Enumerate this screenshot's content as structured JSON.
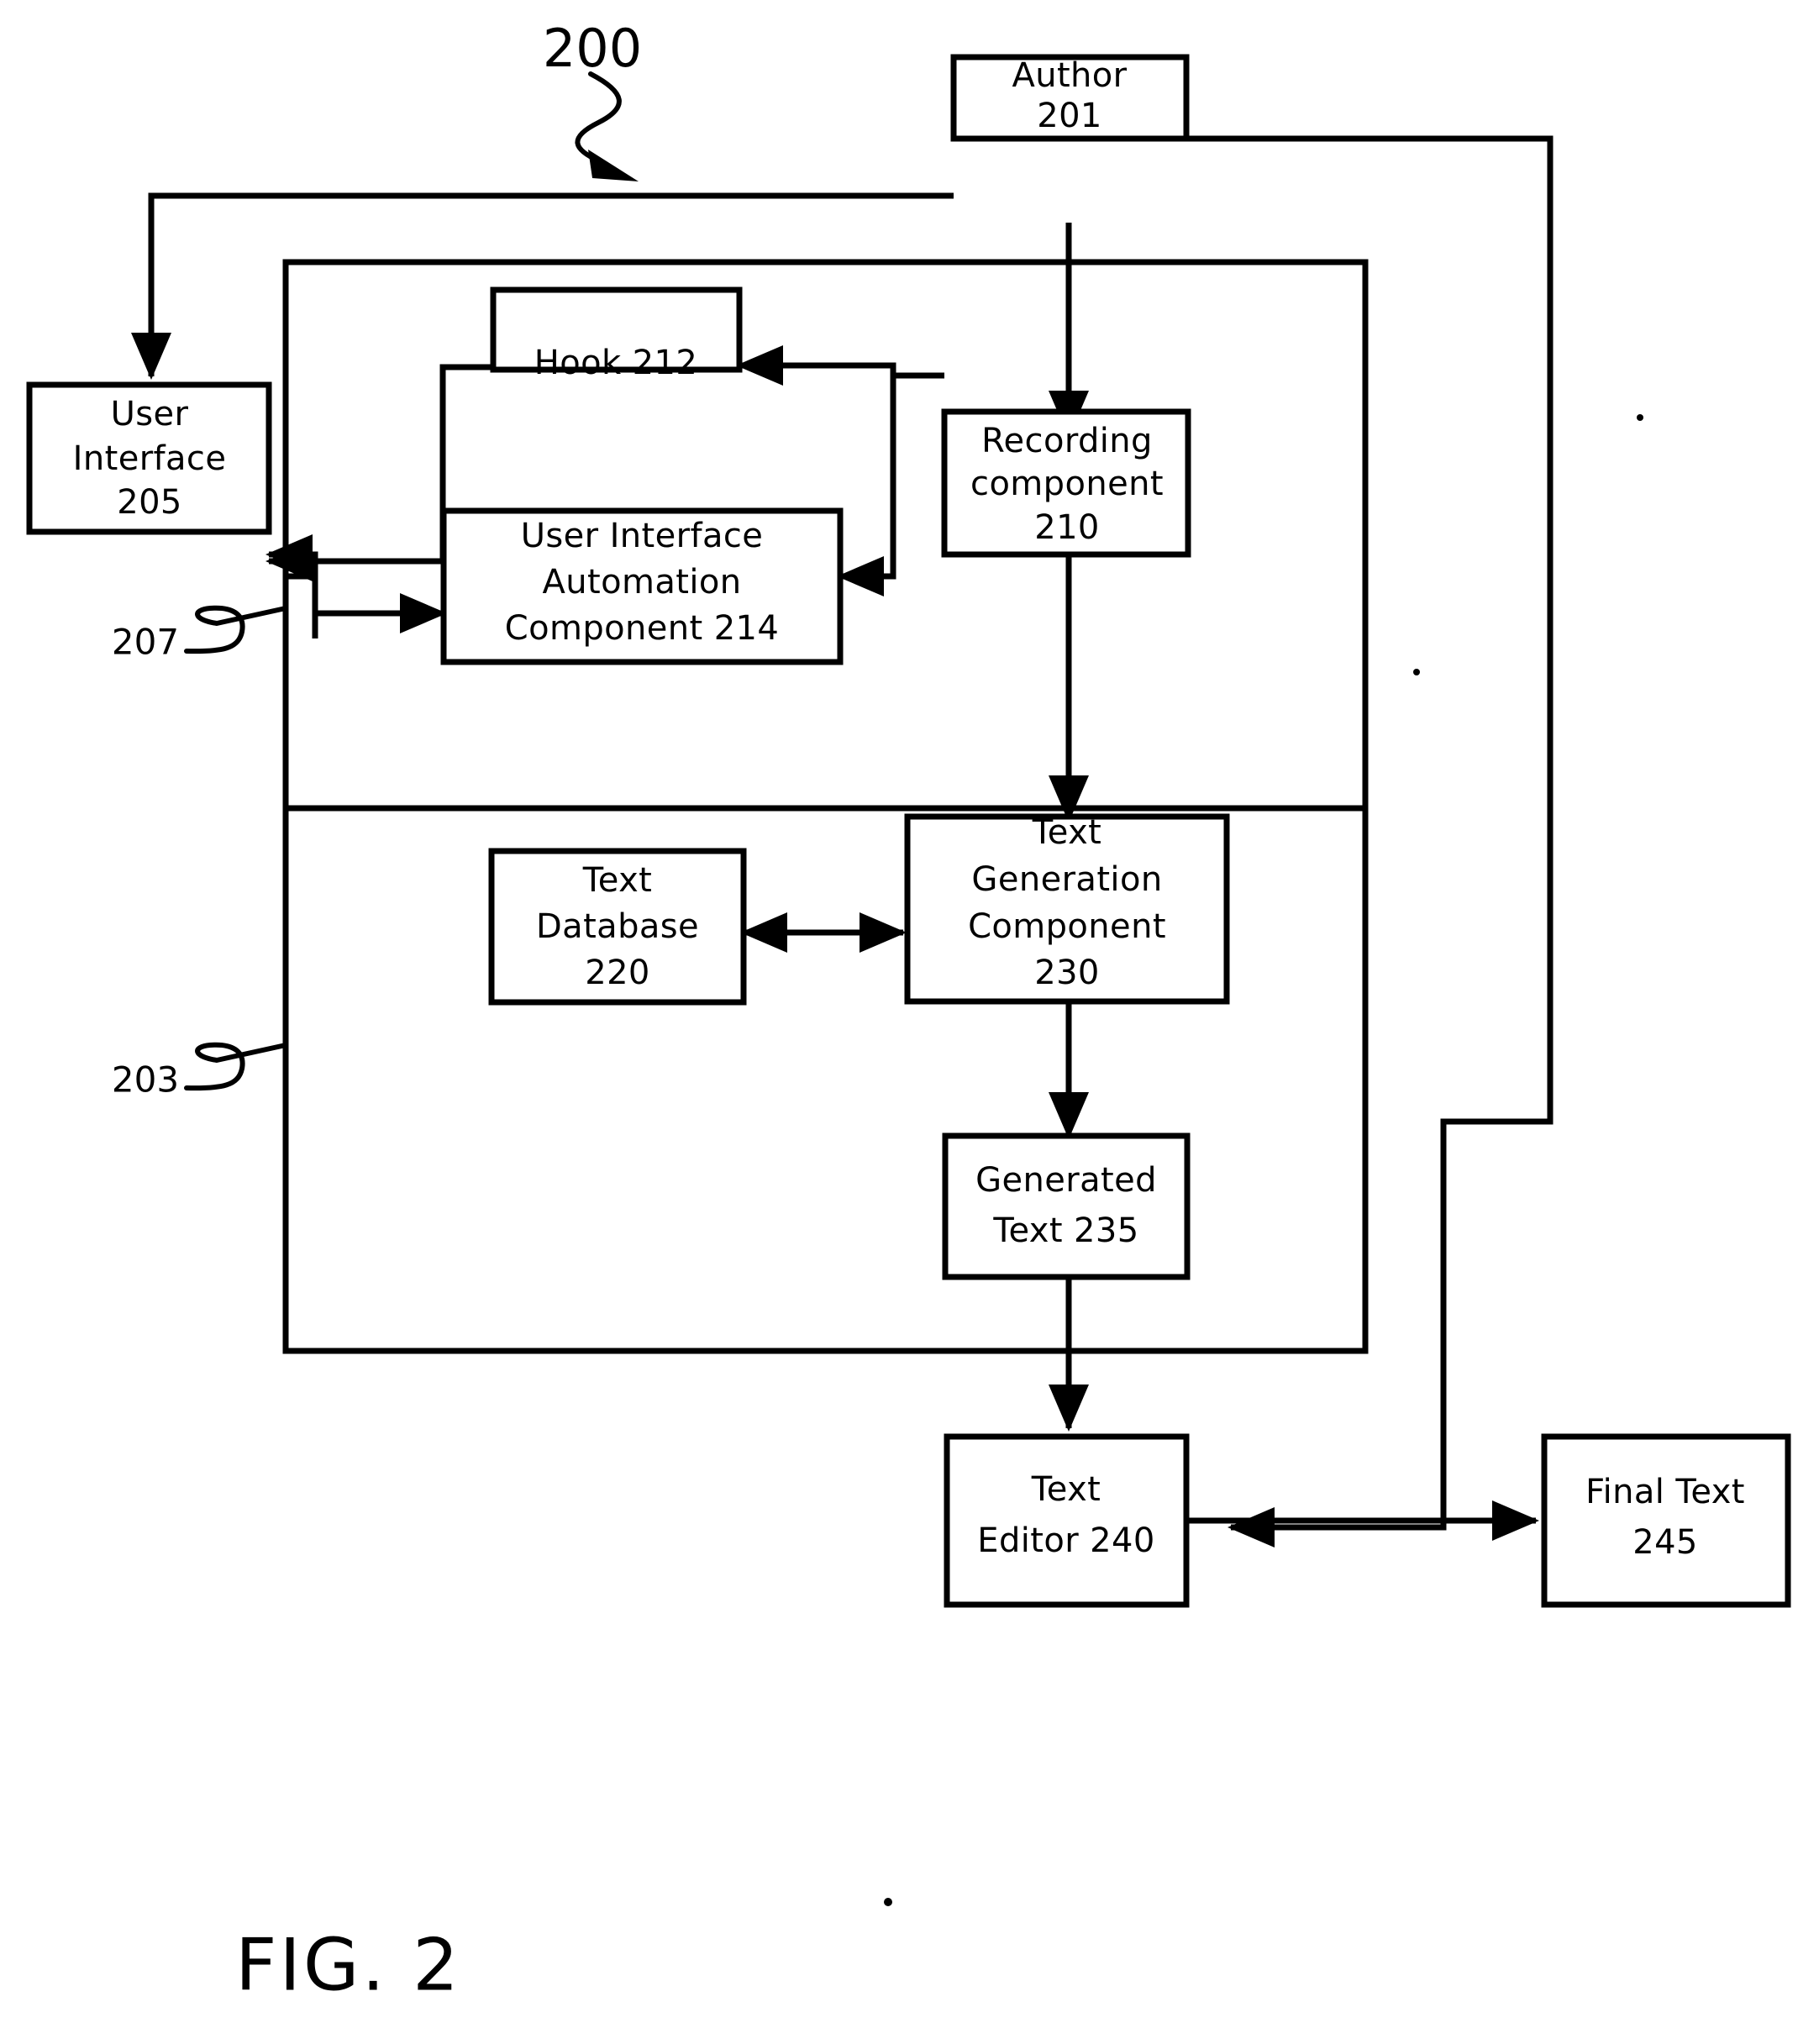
{
  "figure": {
    "caption": "FIG. 2",
    "system_ref": "200",
    "ref_207": "207",
    "ref_203": "203"
  },
  "nodes": {
    "author": {
      "id": "201",
      "lines": [
        "Author",
        "201"
      ]
    },
    "user_interface": {
      "id": "205",
      "lines": [
        "User",
        "Interface",
        "205"
      ]
    },
    "hook": {
      "id": "212",
      "lines": [
        "Hook 212"
      ]
    },
    "recording": {
      "id": "210",
      "lines": [
        "Recording",
        "component",
        "210"
      ]
    },
    "uia": {
      "id": "214",
      "lines": [
        "User Interface",
        "Automation",
        "Component 214"
      ]
    },
    "text_db": {
      "id": "220",
      "lines": [
        "Text",
        "Database",
        "220"
      ]
    },
    "text_gen": {
      "id": "230",
      "lines": [
        "Text",
        "Generation",
        "Component",
        "230"
      ]
    },
    "generated": {
      "id": "235",
      "lines": [
        "Generated",
        "Text 235"
      ]
    },
    "text_editor": {
      "id": "240",
      "lines": [
        "Text",
        "Editor 240"
      ]
    },
    "final_text": {
      "id": "245",
      "lines": [
        "Final Text",
        "245"
      ]
    }
  },
  "node_text": {
    "author_l1": "Author",
    "author_l2": "201",
    "ui_l1": "User",
    "ui_l2": "Interface",
    "ui_l3": "205",
    "hook_l1": "Hook 212",
    "rec_l1": "Recording",
    "rec_l2": "component",
    "rec_l3": "210",
    "uia_l1": "User Interface",
    "uia_l2": "Automation",
    "uia_l3": "Component 214",
    "db_l1": "Text",
    "db_l2": "Database",
    "db_l3": "220",
    "gen_l1": "Text",
    "gen_l2": "Generation",
    "gen_l3": "Component",
    "gen_l4": "230",
    "gtext_l1": "Generated",
    "gtext_l2": "Text 235",
    "editor_l1": "Text",
    "editor_l2": "Editor 240",
    "final_l1": "Final Text",
    "final_l2": "245"
  },
  "colors": {
    "stroke": "#000000",
    "fill": "#ffffff",
    "background": "#ffffff"
  },
  "connections": [
    {
      "from": "author",
      "to": "user_interface",
      "label": ""
    },
    {
      "from": "author",
      "to": "recording",
      "label": ""
    },
    {
      "from": "author",
      "to": "text_editor",
      "label": ""
    },
    {
      "from": "recording",
      "to": "hook",
      "label": ""
    },
    {
      "from": "recording",
      "to": "uia",
      "label": ""
    },
    {
      "from": "hook",
      "to": "user_interface",
      "label": ""
    },
    {
      "from": "uia",
      "to": "user_interface",
      "label": ""
    },
    {
      "from": "uia",
      "to": "recording",
      "label": ""
    },
    {
      "from": "recording",
      "to": "text_gen",
      "label": ""
    },
    {
      "from": "text_db",
      "to": "text_gen",
      "label": "bidirectional"
    },
    {
      "from": "text_gen",
      "to": "generated",
      "label": ""
    },
    {
      "from": "generated",
      "to": "text_editor",
      "label": ""
    },
    {
      "from": "text_editor",
      "to": "final_text",
      "label": ""
    }
  ]
}
